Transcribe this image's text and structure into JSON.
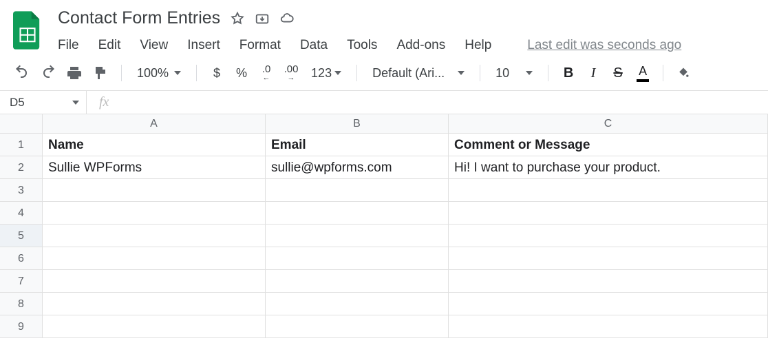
{
  "doc": {
    "title": "Contact Form Entries"
  },
  "menu": {
    "file": "File",
    "edit": "Edit",
    "view": "View",
    "insert": "Insert",
    "format": "Format",
    "data": "Data",
    "tools": "Tools",
    "addons": "Add-ons",
    "help": "Help",
    "last_edit": "Last edit was seconds ago"
  },
  "toolbar": {
    "zoom": "100%",
    "currency": "$",
    "percent": "%",
    "dec_dec": ".0",
    "inc_dec": ".00",
    "num_format": "123",
    "font": "Default (Ari...",
    "font_size": "10",
    "bold": "B",
    "italic": "I",
    "strike": "S",
    "text_color": "A"
  },
  "fx": {
    "cell": "D5",
    "label": "fx",
    "value": ""
  },
  "grid": {
    "col_labels": [
      "A",
      "B",
      "C"
    ],
    "row_labels": [
      "1",
      "2",
      "3",
      "4",
      "5",
      "6",
      "7",
      "8",
      "9"
    ],
    "selected_row": "5",
    "headers": [
      "Name",
      "Email",
      "Comment or Message"
    ],
    "data_row": [
      "Sullie WPForms",
      "sullie@wpforms.com",
      "Hi! I want to purchase your product."
    ]
  }
}
